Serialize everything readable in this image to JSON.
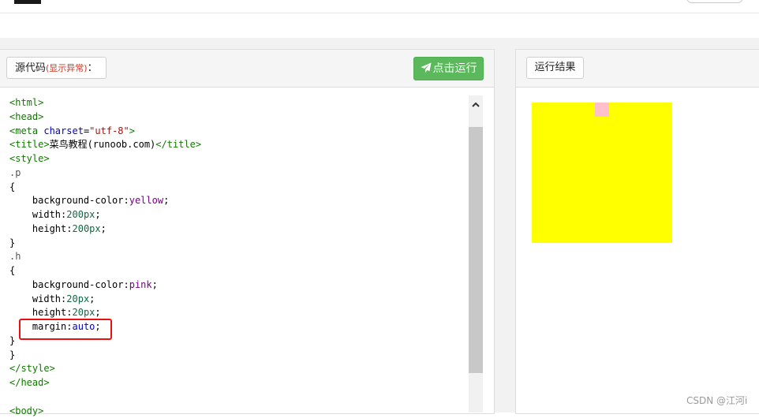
{
  "source_panel": {
    "label": "源代码",
    "label_note": "(显示异常)",
    "label_suffix": "：",
    "run_button": "点击运行"
  },
  "result_panel": {
    "label": "运行结果"
  },
  "code": [
    [
      [
        "tag",
        "<html>"
      ]
    ],
    [
      [
        "tag",
        "<head>"
      ]
    ],
    [
      [
        "tag",
        "<meta"
      ],
      [
        "txt",
        " "
      ],
      [
        "attr",
        "charset"
      ],
      [
        "txt",
        "="
      ],
      [
        "str",
        "\"utf-8\""
      ],
      [
        "tag",
        ">"
      ]
    ],
    [
      [
        "tag",
        "<title>"
      ],
      [
        "txt",
        "菜鸟教程(runoob.com)"
      ],
      [
        "tag",
        "</title>"
      ]
    ],
    [
      [
        "tag",
        "<style>"
      ]
    ],
    [
      [
        "sel",
        ".p"
      ]
    ],
    [
      [
        "txt",
        "{"
      ]
    ],
    [
      [
        "txt",
        "    "
      ],
      [
        "prop",
        "background-color"
      ],
      [
        "txt",
        ":"
      ],
      [
        "kw",
        "yellow"
      ],
      [
        "txt",
        ";"
      ]
    ],
    [
      [
        "txt",
        "    "
      ],
      [
        "prop",
        "width"
      ],
      [
        "txt",
        ":"
      ],
      [
        "num",
        "200px"
      ],
      [
        "txt",
        ";"
      ]
    ],
    [
      [
        "txt",
        "    "
      ],
      [
        "prop",
        "height"
      ],
      [
        "txt",
        ":"
      ],
      [
        "num",
        "200px"
      ],
      [
        "txt",
        ";"
      ]
    ],
    [
      [
        "txt",
        "}"
      ]
    ],
    [
      [
        "sel",
        ".h"
      ]
    ],
    [
      [
        "txt",
        "{"
      ]
    ],
    [
      [
        "txt",
        "    "
      ],
      [
        "prop",
        "background-color"
      ],
      [
        "txt",
        ":"
      ],
      [
        "kw",
        "pink"
      ],
      [
        "txt",
        ";"
      ]
    ],
    [
      [
        "txt",
        "    "
      ],
      [
        "prop",
        "width"
      ],
      [
        "txt",
        ":"
      ],
      [
        "num",
        "20px"
      ],
      [
        "txt",
        ";"
      ]
    ],
    [
      [
        "txt",
        "    "
      ],
      [
        "prop",
        "height"
      ],
      [
        "txt",
        ":"
      ],
      [
        "num",
        "20px"
      ],
      [
        "txt",
        ";"
      ]
    ],
    [
      [
        "txt",
        "    "
      ],
      [
        "prop",
        "margin"
      ],
      [
        "txt",
        ":"
      ],
      [
        "attr",
        "auto"
      ],
      [
        "txt",
        ";"
      ]
    ],
    [
      [
        "txt",
        "}"
      ]
    ],
    [
      [
        "txt",
        "}"
      ]
    ],
    [
      [
        "tag",
        "</style>"
      ]
    ],
    [
      [
        "tag",
        "</head>"
      ]
    ],
    [
      [
        "txt",
        ""
      ]
    ],
    [
      [
        "tag",
        "<body>"
      ]
    ]
  ],
  "colors": {
    "run_button": "#5cb85c",
    "box_p": "yellow",
    "box_h": "pink",
    "highlight": "#e8110f"
  },
  "icons": [
    "paper-plane-icon",
    "chevron-up-icon"
  ],
  "watermark": "CSDN @江河i"
}
